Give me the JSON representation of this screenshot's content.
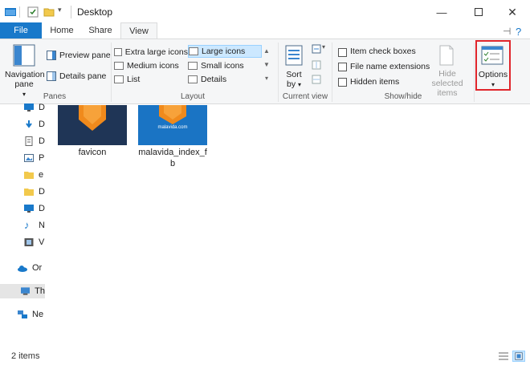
{
  "titlebar": {
    "title": "Desktop",
    "minimize_icon": "minimize-icon",
    "maximize_icon": "maximize-icon",
    "close_icon": "close-icon"
  },
  "tabs": [
    {
      "label": "File"
    },
    {
      "label": "Home"
    },
    {
      "label": "Share"
    },
    {
      "label": "View"
    }
  ],
  "ribbon": {
    "panes": {
      "navigation_pane": "Navigation pane",
      "preview_pane": "Preview pane",
      "details_pane": "Details pane",
      "group_label": "Panes"
    },
    "layout": {
      "items": [
        "Extra large icons",
        "Large icons",
        "Medium icons",
        "Small icons",
        "List",
        "Details"
      ],
      "selected": "Large icons",
      "group_label": "Layout"
    },
    "current_view": {
      "sort_by": "Sort by",
      "group_label": "Current view"
    },
    "show_hide": {
      "item_check_boxes": "Item check boxes",
      "file_name_extensions": "File name extensions",
      "hidden_items": "Hidden items",
      "hide_selected_items": "Hide selected items",
      "group_label": "Show/hide"
    },
    "options": {
      "label": "Options",
      "highlight_color": "#e0252b"
    }
  },
  "navpane": {
    "items": [
      "D",
      "D",
      "D",
      "P",
      "e",
      "D",
      "D",
      "N",
      "V",
      "Or",
      "Th",
      "Ne"
    ],
    "selected": "Th"
  },
  "files": [
    {
      "name": "favicon"
    },
    {
      "name": "malavida_index_f",
      "name_line2": "b",
      "thumb_caption": "malavida.com"
    }
  ],
  "status": {
    "item_count": "2 items"
  },
  "colors": {
    "accent": "#1979ca",
    "selection": "#cce8ff",
    "thumb_dark": "#1f3556",
    "thumb_blue": "#1a74c4",
    "orange": "#f08a1c"
  }
}
